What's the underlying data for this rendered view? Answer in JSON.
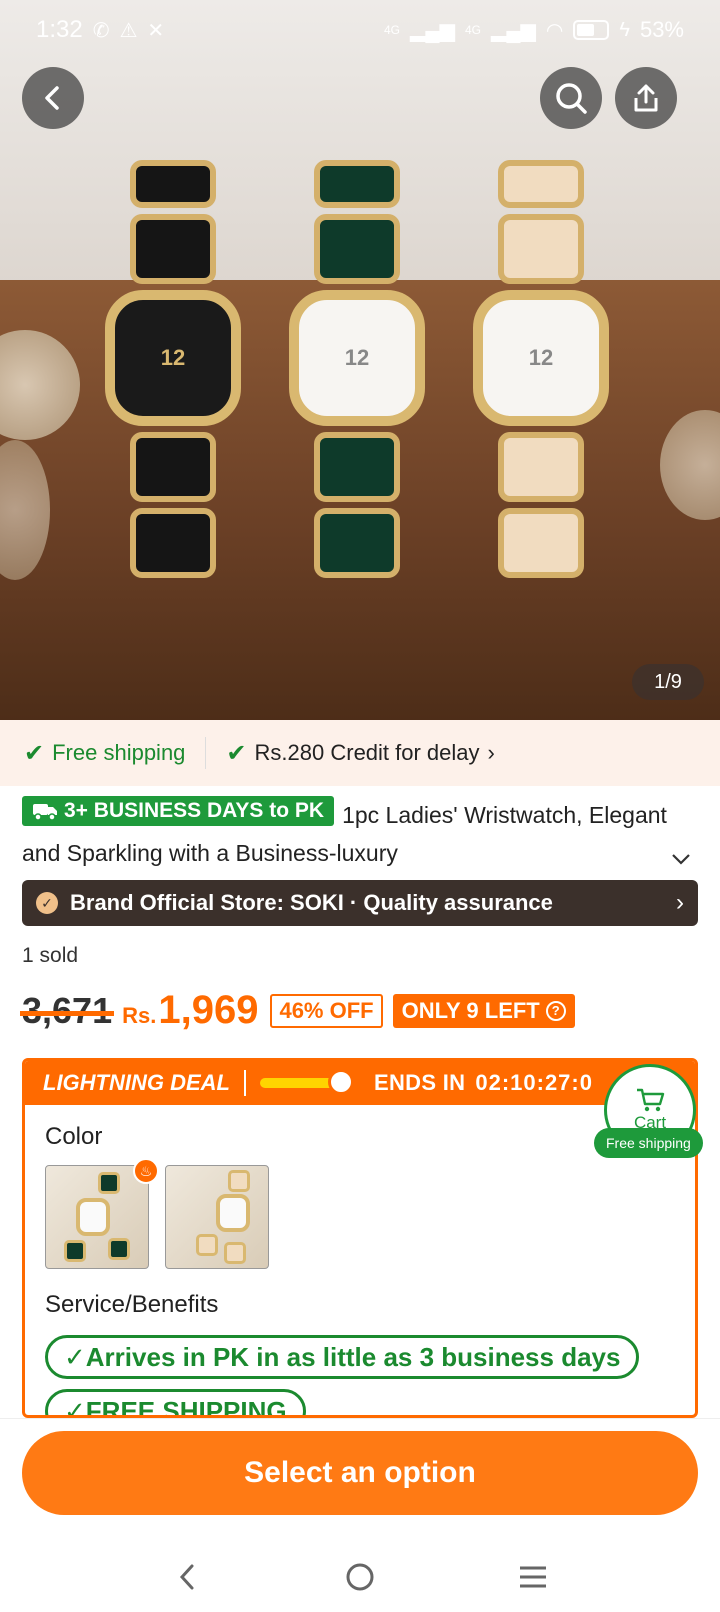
{
  "status": {
    "time": "1:32",
    "battery": "53%",
    "signal1": "4G",
    "signal2": "4G"
  },
  "gallery": {
    "indicator": "1/9",
    "current": 1,
    "total": 9
  },
  "shipping": {
    "free": "Free shipping",
    "credit": "Rs.280 Credit for delay"
  },
  "product": {
    "delivery_badge": "3+ BUSINESS DAYS to PK",
    "title": "1pc Ladies' Wristwatch, Elegant and Sparkling with a Business-luxury",
    "brand": "Brand Official Store: SOKI · Quality assurance",
    "sold": "1 sold",
    "old_price": "3,671",
    "currency": "Rs.",
    "price": "1,969",
    "discount": "46% OFF",
    "stock": "ONLY 9 LEFT"
  },
  "deal": {
    "label": "LIGHTNING DEAL",
    "ends_label": "ENDS IN",
    "timer": "02:10:27:0",
    "progress": 0.85
  },
  "options": {
    "color_label": "Color",
    "service_label": "Service/Benefits",
    "services": [
      "✓Arrives in PK in as little as 3 business days",
      "✓FREE SHIPPING"
    ]
  },
  "cart": {
    "label": "Cart",
    "free": "Free shipping"
  },
  "cta": {
    "select": "Select an option"
  },
  "colors": {
    "accent": "#ff6a00",
    "green": "#1e9a3b",
    "brand_bar": "#3b302b"
  }
}
